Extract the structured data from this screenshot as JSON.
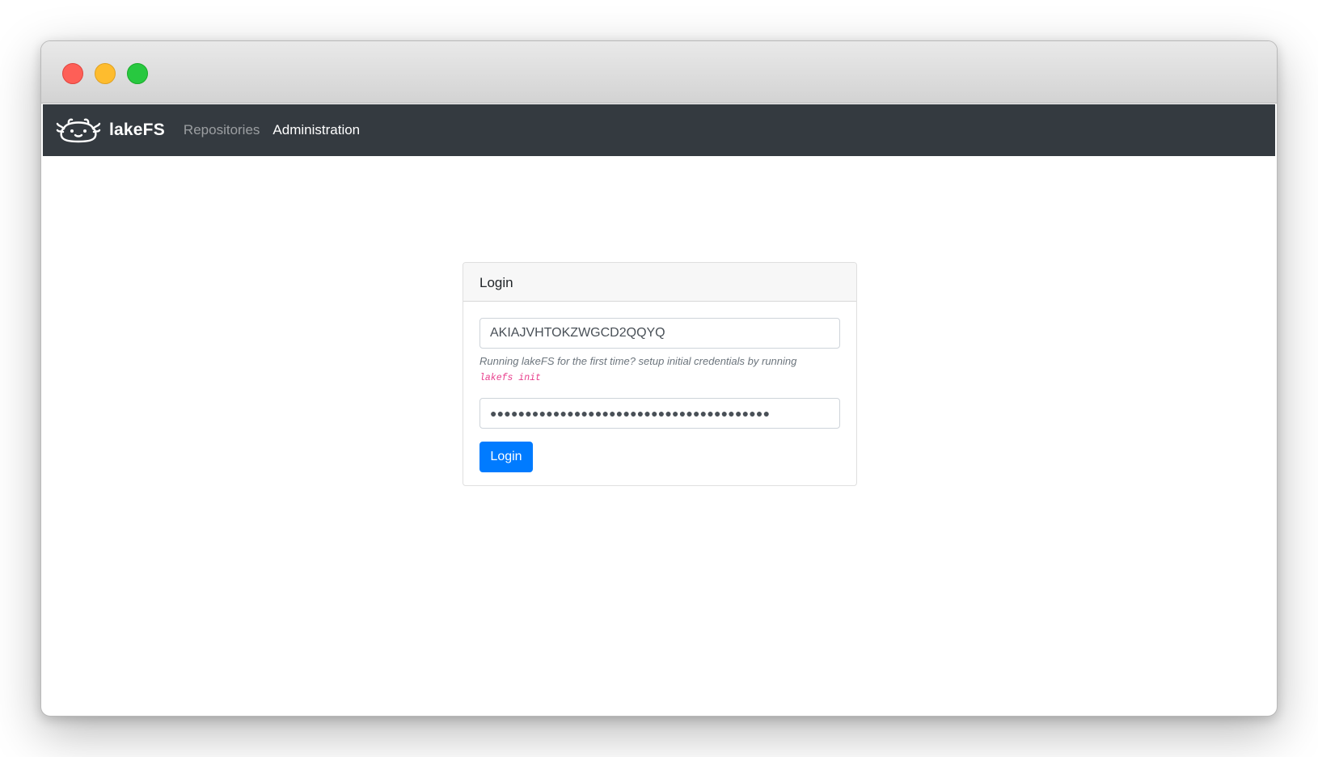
{
  "navbar": {
    "brand_icon": "axolotl-logo-icon",
    "brand_text": "lakeFS",
    "links": [
      {
        "label": "Repositories",
        "active": false
      },
      {
        "label": "Administration",
        "active": true
      }
    ],
    "background": "#343a40"
  },
  "login": {
    "title": "Login",
    "access_key_value": "AKIAJVHTOKZWGCD2QQYQ",
    "help_text": "Running lakeFS for the first time? setup initial credentials by running",
    "help_command": "lakefs init",
    "secret_key_masked": "●●●●●●●●●●●●●●●●●●●●●●●●●●●●●●●●●●●●●●●●",
    "submit_label": "Login",
    "accent": "#007bff"
  },
  "window": {
    "controls": [
      "close",
      "minimize",
      "zoom"
    ]
  }
}
